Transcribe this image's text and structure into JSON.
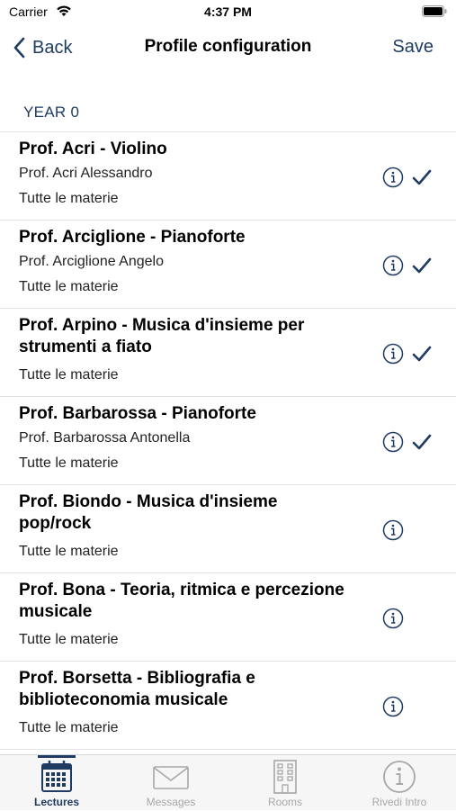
{
  "status_bar": {
    "carrier": "Carrier",
    "time": "4:37 PM"
  },
  "nav": {
    "back_label": "Back",
    "title": "Profile configuration",
    "save_label": "Save"
  },
  "section": {
    "header": "YEAR 0"
  },
  "rows": [
    {
      "title": "Prof. Acri - Violino",
      "subtitle": "Prof. Acri Alessandro",
      "materie": "Tutte le materie",
      "checked": true
    },
    {
      "title": "Prof. Arciglione - Pianoforte",
      "subtitle": "Prof. Arciglione Angelo",
      "materie": "Tutte le materie",
      "checked": true
    },
    {
      "title": "Prof. Arpino - Musica d'insieme per strumenti a fiato",
      "subtitle": "",
      "materie": "Tutte le materie",
      "checked": true
    },
    {
      "title": "Prof. Barbarossa - Pianoforte",
      "subtitle": "Prof. Barbarossa Antonella",
      "materie": "Tutte le materie",
      "checked": true
    },
    {
      "title": "Prof. Biondo - Musica d'insieme pop/rock",
      "subtitle": "",
      "materie": "Tutte le materie",
      "checked": false
    },
    {
      "title": "Prof. Bona - Teoria, ritmica e percezione musicale",
      "subtitle": "",
      "materie": "Tutte le materie",
      "checked": false
    },
    {
      "title": "Prof. Borsetta - Bibliografia e biblioteconomia musicale",
      "subtitle": "",
      "materie": "Tutte le materie",
      "checked": false
    }
  ],
  "tabbar": {
    "tabs": [
      {
        "label": "Lectures",
        "icon": "calendar-icon",
        "active": true
      },
      {
        "label": "Messages",
        "icon": "envelope-icon",
        "active": false
      },
      {
        "label": "Rooms",
        "icon": "building-icon",
        "active": false
      },
      {
        "label": "Rivedi Intro",
        "icon": "info-icon",
        "active": false
      }
    ]
  },
  "colors": {
    "accent": "#1f3b63",
    "inactive": "#a7a7a7",
    "separator": "#e3e3e3"
  }
}
